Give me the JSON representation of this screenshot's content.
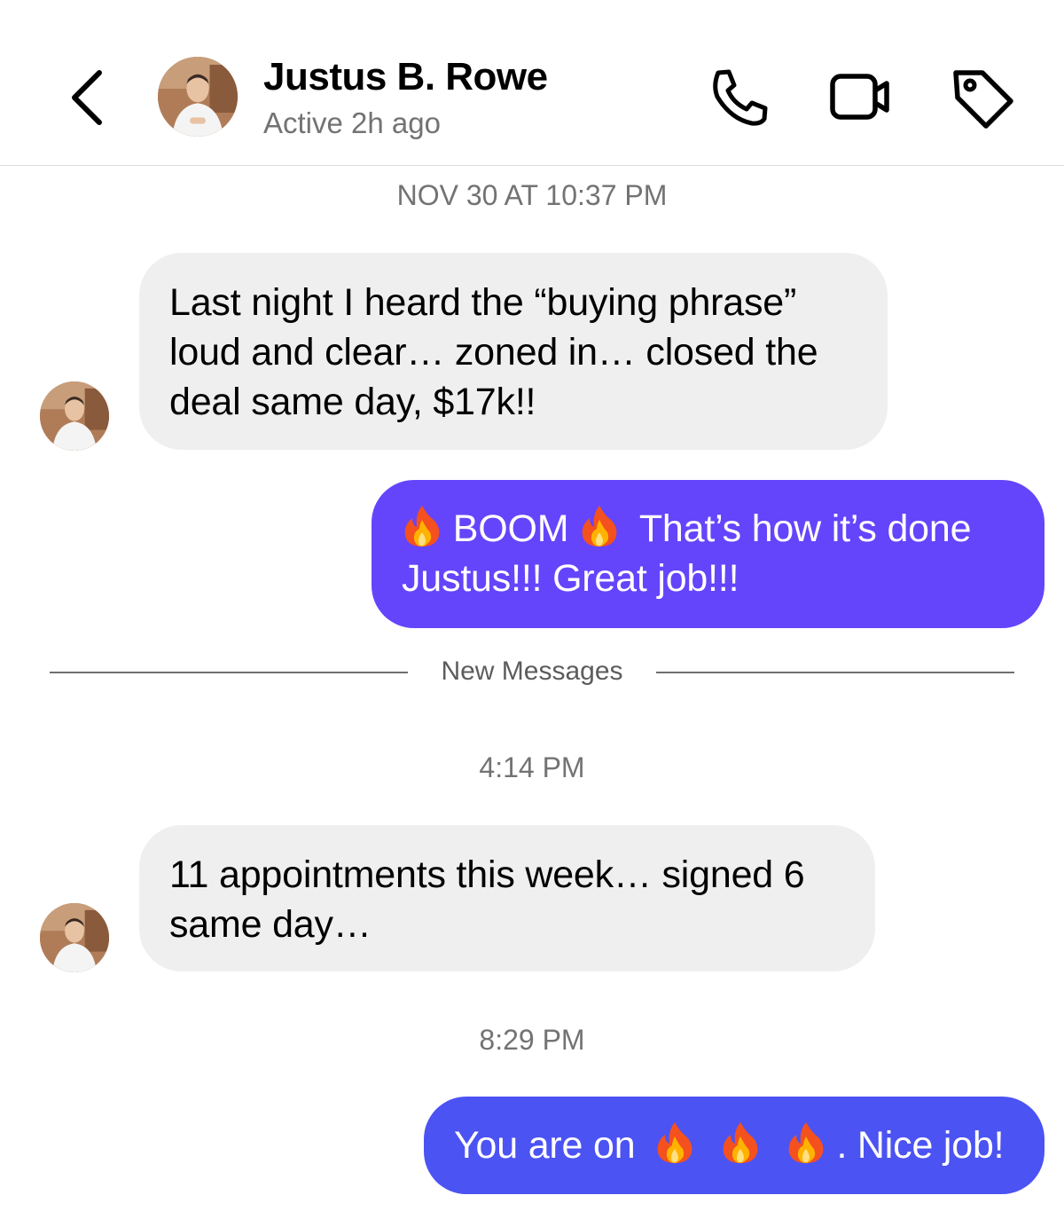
{
  "header": {
    "back_icon": "chevron-left-icon",
    "contact_name": "Justus B. Rowe",
    "status": "Active 2h ago",
    "actions": [
      {
        "name": "call",
        "icon": "phone-icon"
      },
      {
        "name": "video",
        "icon": "video-camera-icon"
      },
      {
        "name": "tag",
        "icon": "tag-icon"
      }
    ]
  },
  "conversation": {
    "timestamp_1": "NOV 30 AT 10:37 PM",
    "msg_1": {
      "from": "Justus B. Rowe",
      "lines": [
        "Last night I heard the “buying phrase”",
        "loud and clear… zoned in… closed the",
        "deal same day, $17k!!"
      ]
    },
    "msg_2": {
      "from": "me",
      "word_boom": "BOOM",
      "line1_rest": "That’s how it’s done",
      "line2": "Justus!!! Great job!!!"
    },
    "new_messages_label": "New Messages",
    "timestamp_2": "4:14 PM",
    "msg_3": {
      "from": "Justus B. Rowe",
      "lines": [
        "11 appointments this week… signed 6",
        "same day…"
      ]
    },
    "timestamp_3": "8:29 PM",
    "msg_4": {
      "from": "me",
      "before": "You are on",
      "after": ". Nice job!"
    }
  },
  "colors": {
    "sent_bubble_purple": "#6445fb",
    "sent_bubble_blue": "#4c53f3",
    "received_bubble": "#efefef",
    "muted_text": "#737373"
  }
}
